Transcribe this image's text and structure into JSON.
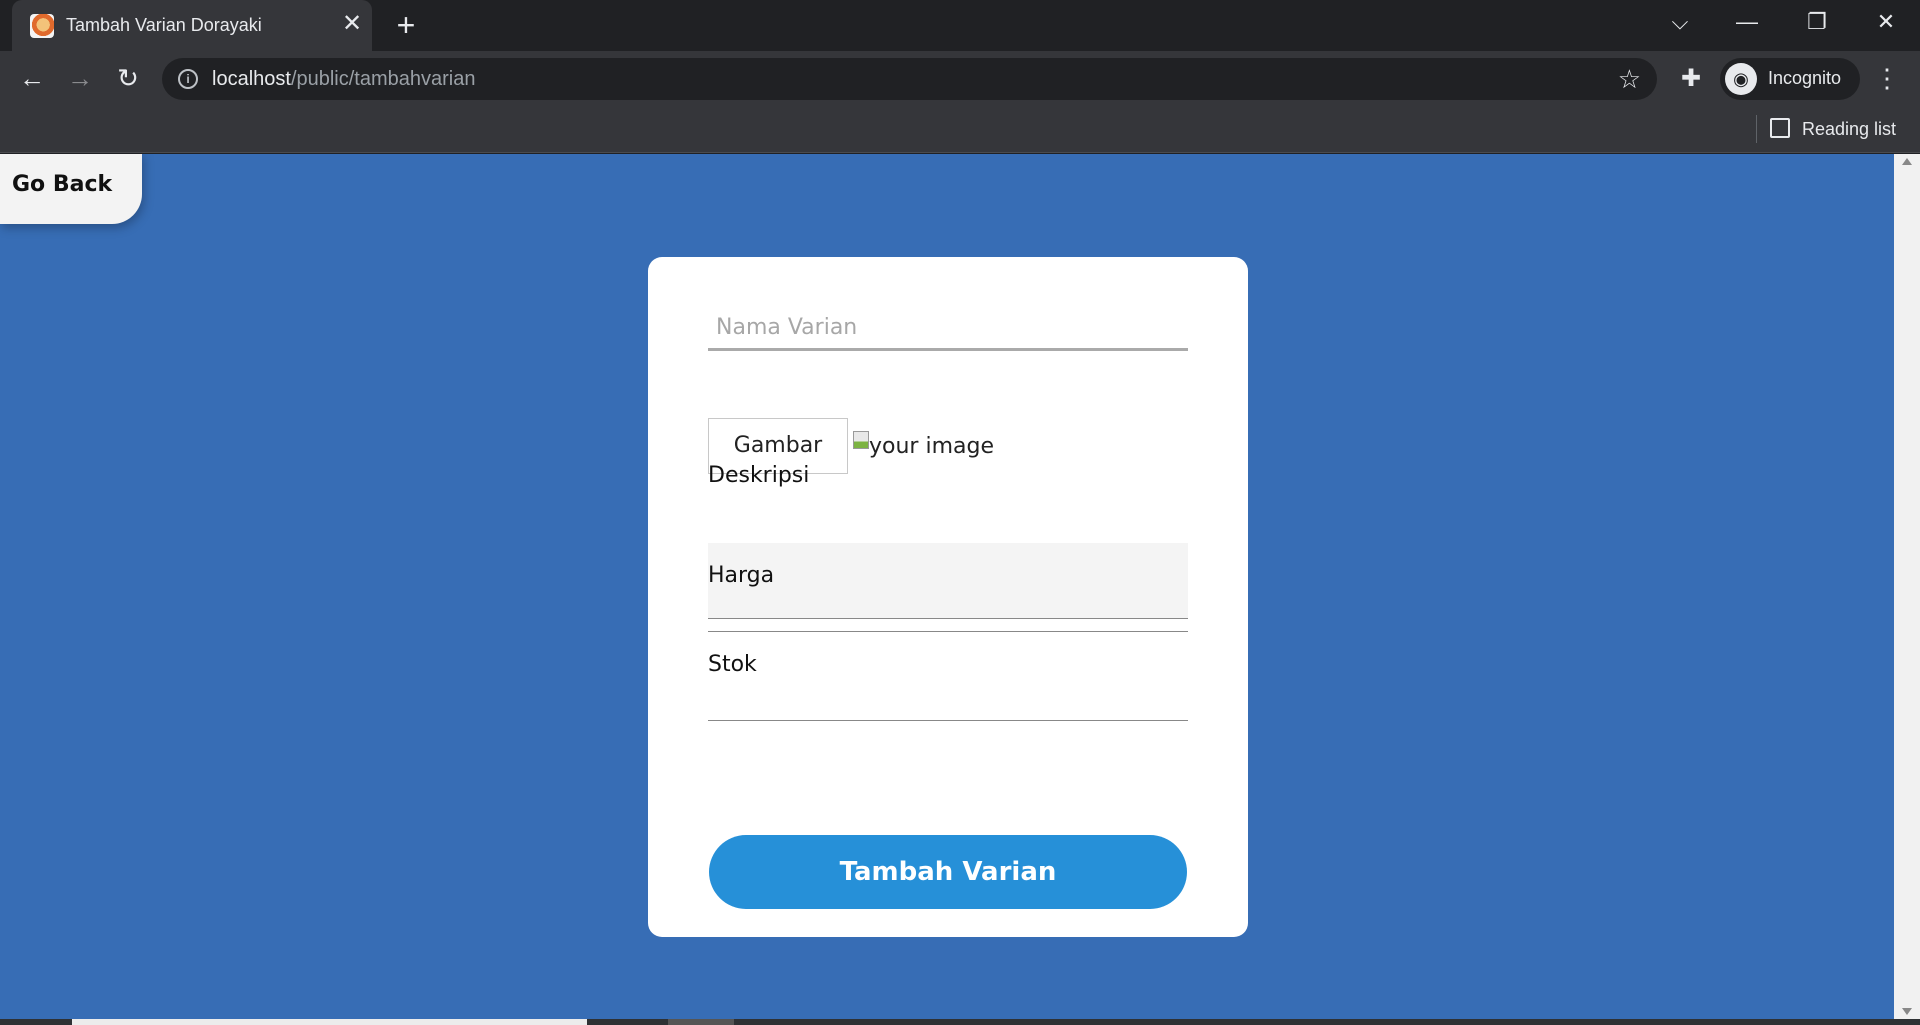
{
  "browser": {
    "tab_title": "Tambah Varian Dorayaki",
    "url_host": "localhost",
    "url_path": "/public/tambahvarian",
    "profile_label": "Incognito",
    "reading_list_label": "Reading list"
  },
  "page": {
    "go_back_label": "Go Back",
    "nama_placeholder": "Nama Varian",
    "gambar_label": "Gambar",
    "image_alt": "your image",
    "deskripsi_label": "Deskripsi",
    "harga_label": "Harga",
    "stok_label": "Stok",
    "submit_label": "Tambah Varian"
  },
  "colors": {
    "page_background": "#376db5",
    "card_background": "#ffffff",
    "submit_button": "#2690d8"
  }
}
